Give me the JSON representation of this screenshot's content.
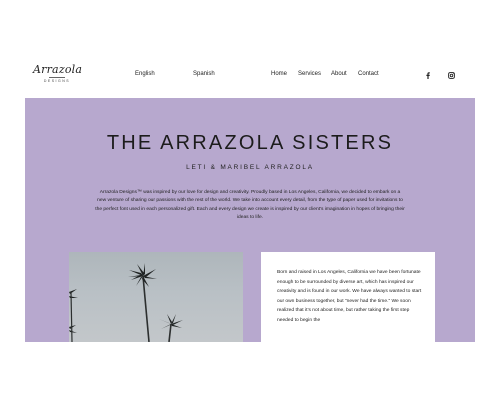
{
  "brand": {
    "logo_script": "Arrazola",
    "logo_sub": "DESIGNS"
  },
  "languages": [
    "English",
    "Spanish"
  ],
  "nav": [
    "Home",
    "Services",
    "About",
    "Contact"
  ],
  "social": [
    {
      "name": "facebook-icon",
      "glyph": "f"
    },
    {
      "name": "instagram-icon",
      "glyph": "◘"
    }
  ],
  "hero": {
    "title": "THE ARRAZOLA SISTERS",
    "subtitle": "LETI & MARIBEL ARRAZOLA",
    "text": "Arrazola Designs™ was inspired by our love for design and creativity. Proudly based in Los Angeles, California, we decided to embark on a new venture of sharing our passions with the rest of the world. We take into account every detail, from the type of paper used for invitations to the perfect font used in each personalized gift. Each and every design we create is inspired by our client's imagination in hopes of bringing their ideas to life.",
    "background": "#b7a8ce"
  },
  "about_card": {
    "text": "Born and raised in Los Angeles, California we have been fortunate enough to be surrounded by diverse art, which has inspired our creativity and is found in our work. We have always wanted to start our own business together, but “never had the time.” We soon realized that it’s not about time, but rather taking the first step needed to begin the"
  }
}
